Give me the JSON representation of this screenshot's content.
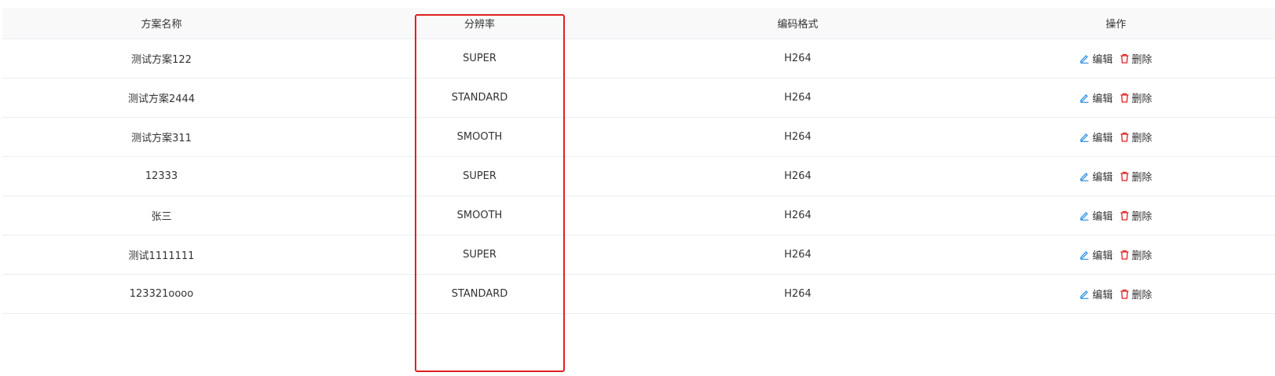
{
  "table": {
    "columns": [
      "方案名称",
      "分辨率",
      "编码格式",
      "操作"
    ],
    "rows": [
      {
        "name": "测试方案122",
        "resolution": "SUPER",
        "codec": "H264"
      },
      {
        "name": "测试方案2444",
        "resolution": "STANDARD",
        "codec": "H264"
      },
      {
        "name": "测试方案311",
        "resolution": "SMOOTH",
        "codec": "H264"
      },
      {
        "name": "12333",
        "resolution": "SUPER",
        "codec": "H264"
      },
      {
        "name": "张三",
        "resolution": "SMOOTH",
        "codec": "H264"
      },
      {
        "name": "测试1111111",
        "resolution": "SUPER",
        "codec": "H264"
      },
      {
        "name": "123321oooo",
        "resolution": "STANDARD",
        "codec": "H264"
      }
    ],
    "actions": {
      "edit_label": "编辑",
      "delete_label": "删除"
    }
  },
  "icons": {
    "edit": "edit-icon",
    "delete": "trash-icon"
  },
  "colors": {
    "edit_icon": "#1e88e5",
    "delete_icon": "#e02020",
    "highlight_box": "#e02020",
    "header_bg": "#f9f9f9",
    "row_border": "#ebeef5"
  }
}
